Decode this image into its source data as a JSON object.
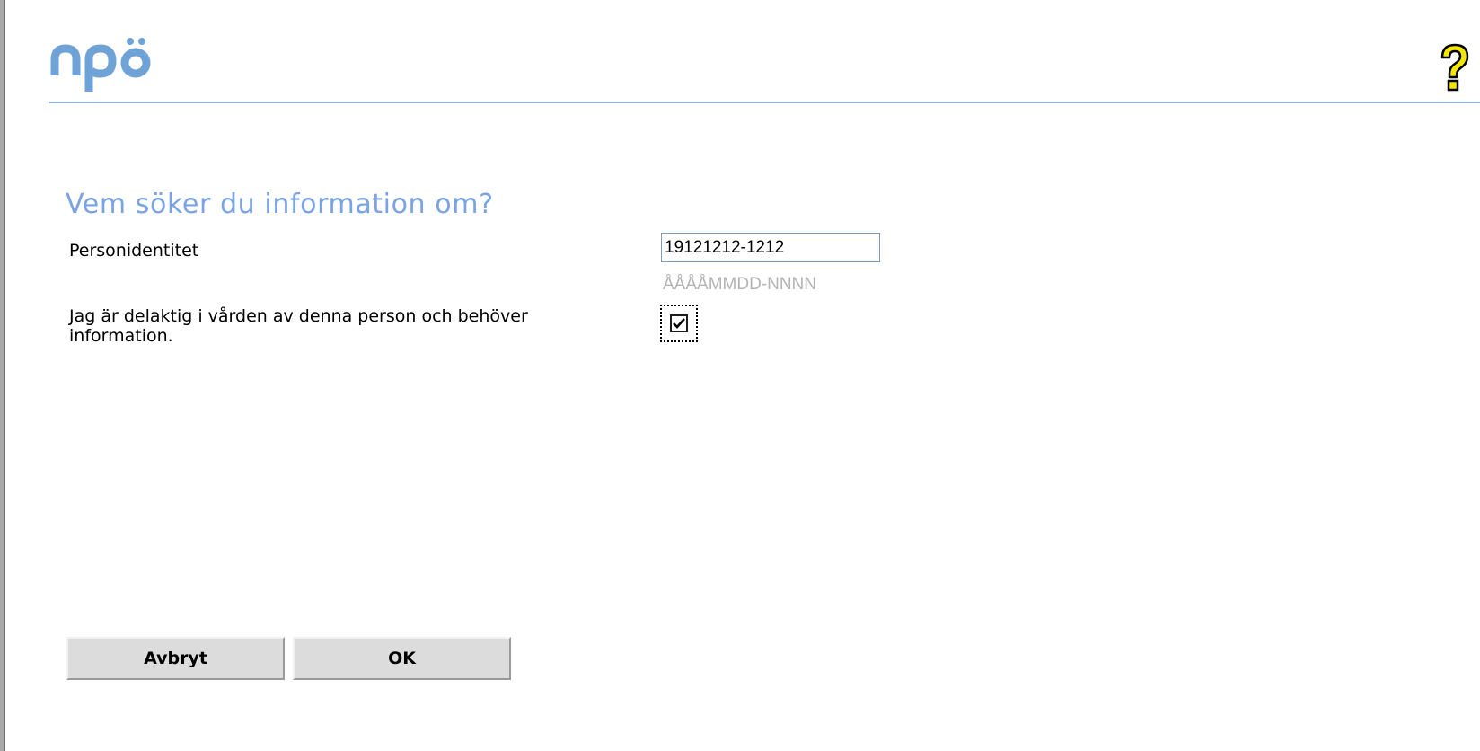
{
  "app": {
    "logo_text": "npö"
  },
  "header": {
    "help_icon": "question-mark-icon"
  },
  "form": {
    "title": "Vem söker du information om?",
    "person_id_label": "Personidentitet",
    "person_id_value": "19121212-1212",
    "person_id_hint": "ÅÅÅÅMMDD-NNNN",
    "involved_label": "Jag är delaktig i vården av denna person och behöver information.",
    "involved_checked": true
  },
  "buttons": {
    "cancel_label": "Avbryt",
    "ok_label": "OK"
  },
  "colors": {
    "accent": "#7aa3e6",
    "rule": "#8fb1e6",
    "help_icon": "#f5e600"
  }
}
